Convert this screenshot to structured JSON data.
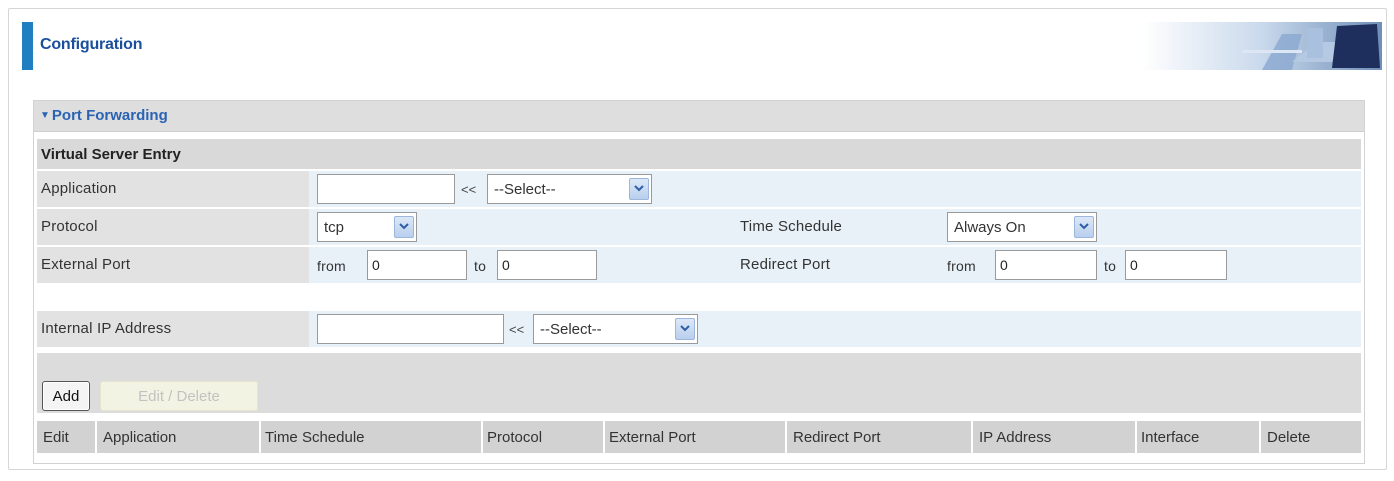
{
  "header": {
    "title": "Configuration"
  },
  "panel": {
    "title": "Port Forwarding",
    "section_title": "Virtual Server Entry"
  },
  "form": {
    "application": {
      "label": "Application",
      "value": "",
      "separator": "<<",
      "select_value": "--Select--"
    },
    "protocol": {
      "label": "Protocol",
      "value": "tcp"
    },
    "time_schedule": {
      "label": "Time Schedule",
      "value": "Always On"
    },
    "external_port": {
      "label": "External Port",
      "from_label": "from",
      "from_value": "0",
      "to_label": "to",
      "to_value": "0"
    },
    "redirect_port": {
      "label": "Redirect Port",
      "from_label": "from",
      "from_value": "0",
      "to_label": "to",
      "to_value": "0"
    },
    "internal_ip": {
      "label": "Internal IP Address",
      "value": "",
      "separator": "<<",
      "select_value": "--Select--"
    }
  },
  "buttons": {
    "add": "Add",
    "edit_delete": "Edit / Delete"
  },
  "table": {
    "columns": [
      "Edit",
      "Application",
      "Time Schedule",
      "Protocol",
      "External Port",
      "Redirect Port",
      "IP Address",
      "Interface",
      "Delete"
    ]
  },
  "colors": {
    "accent": "#1f7fc0",
    "title_blue": "#1a4f9e",
    "row_blue": "#e9f1f8"
  },
  "icons": {
    "dropdown": "chevron-down-icon",
    "collapse": "triangle-down-icon",
    "header_graphic": "office-chairs-banner-image"
  }
}
